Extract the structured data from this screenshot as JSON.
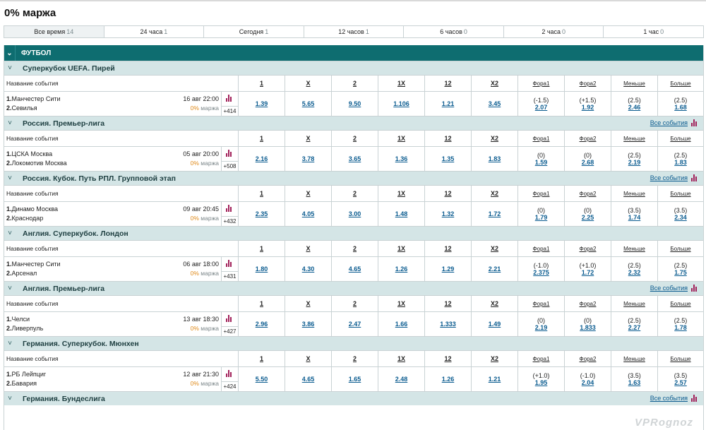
{
  "page": {
    "title": "0% маржа"
  },
  "filters": [
    {
      "label": "Все время",
      "count": "14",
      "active": true
    },
    {
      "label": "24 часа",
      "count": "1"
    },
    {
      "label": "Сегодня",
      "count": "1"
    },
    {
      "label": "12 часов",
      "count": "1"
    },
    {
      "label": "6 часов",
      "count": "0"
    },
    {
      "label": "2 часа",
      "count": "0"
    },
    {
      "label": "1 час",
      "count": "0"
    }
  ],
  "sport": {
    "name": "ФУТБОЛ"
  },
  "columns": {
    "event_name": "Название события",
    "c1": "1",
    "cx": "X",
    "c2": "2",
    "c1x": "1X",
    "c12": "12",
    "cx2": "X2",
    "fora1": "Фора1",
    "fora2": "Фора2",
    "less": "Меньше",
    "more": "Больше"
  },
  "all_events_label": "Все события",
  "margin_suffix": "маржа",
  "margin_value": "0%",
  "leagues": [
    {
      "name": "Суперкубок UEFA. Пирей",
      "show_all": false,
      "event": {
        "team1": "Манчестер Сити",
        "team2": "Севилья",
        "datetime": "16 авг 22:00",
        "more": "+414",
        "odds": [
          "1.39",
          "5.65",
          "9.50",
          "1.106",
          "1.21",
          "3.45"
        ],
        "fora1": {
          "p": "(-1.5)",
          "v": "2.07"
        },
        "fora2": {
          "p": "(+1.5)",
          "v": "1.92"
        },
        "less": {
          "p": "(2.5)",
          "v": "2.46"
        },
        "greater": {
          "p": "(2.5)",
          "v": "1.68"
        }
      }
    },
    {
      "name": "Россия. Премьер-лига",
      "show_all": true,
      "event": {
        "team1": "ЦСКА Москва",
        "team2": "Локомотив Москва",
        "datetime": "05 авг 20:00",
        "more": "+508",
        "odds": [
          "2.16",
          "3.78",
          "3.65",
          "1.36",
          "1.35",
          "1.83"
        ],
        "fora1": {
          "p": "(0)",
          "v": "1.59"
        },
        "fora2": {
          "p": "(0)",
          "v": "2.68"
        },
        "less": {
          "p": "(2.5)",
          "v": "2.19"
        },
        "greater": {
          "p": "(2.5)",
          "v": "1.83"
        }
      }
    },
    {
      "name": "Россия. Кубок. Путь РПЛ. Групповой этап",
      "show_all": true,
      "event": {
        "team1": "Динамо Москва",
        "team2": "Краснодар",
        "datetime": "09 авг 20:45",
        "more": "+432",
        "odds": [
          "2.35",
          "4.05",
          "3.00",
          "1.48",
          "1.32",
          "1.72"
        ],
        "fora1": {
          "p": "(0)",
          "v": "1.79"
        },
        "fora2": {
          "p": "(0)",
          "v": "2.25"
        },
        "less": {
          "p": "(3.5)",
          "v": "1.74"
        },
        "greater": {
          "p": "(3.5)",
          "v": "2.34"
        }
      }
    },
    {
      "name": "Англия. Суперкубок. Лондон",
      "show_all": false,
      "event": {
        "team1": "Манчестер Сити",
        "team2": "Арсенал",
        "datetime": "06 авг 18:00",
        "more": "+431",
        "odds": [
          "1.80",
          "4.30",
          "4.65",
          "1.26",
          "1.29",
          "2.21"
        ],
        "fora1": {
          "p": "(-1.0)",
          "v": "2.375"
        },
        "fora2": {
          "p": "(+1.0)",
          "v": "1.72"
        },
        "less": {
          "p": "(2.5)",
          "v": "2.32"
        },
        "greater": {
          "p": "(2.5)",
          "v": "1.75"
        }
      }
    },
    {
      "name": "Англия. Премьер-лига",
      "show_all": true,
      "event": {
        "team1": "Челси",
        "team2": "Ливерпуль",
        "datetime": "13 авг 18:30",
        "more": "+427",
        "odds": [
          "2.96",
          "3.86",
          "2.47",
          "1.66",
          "1.333",
          "1.49"
        ],
        "fora1": {
          "p": "(0)",
          "v": "2.19"
        },
        "fora2": {
          "p": "(0)",
          "v": "1.833"
        },
        "less": {
          "p": "(2.5)",
          "v": "2.27"
        },
        "greater": {
          "p": "(2.5)",
          "v": "1.78"
        }
      }
    },
    {
      "name": "Германия. Суперкубок. Мюнхен",
      "show_all": false,
      "event": {
        "team1": "РБ Лейпциг",
        "team2": "Бавария",
        "datetime": "12 авг 21:30",
        "more": "+424",
        "odds": [
          "5.50",
          "4.65",
          "1.65",
          "2.48",
          "1.26",
          "1.21"
        ],
        "fora1": {
          "p": "(+1.0)",
          "v": "1.95"
        },
        "fora2": {
          "p": "(-1.0)",
          "v": "2.04"
        },
        "less": {
          "p": "(3.5)",
          "v": "1.63"
        },
        "greater": {
          "p": "(3.5)",
          "v": "2.57"
        }
      }
    },
    {
      "name": "Германия. Бундеслига",
      "show_all": true,
      "event": null
    }
  ],
  "watermark": "VPRognoz"
}
